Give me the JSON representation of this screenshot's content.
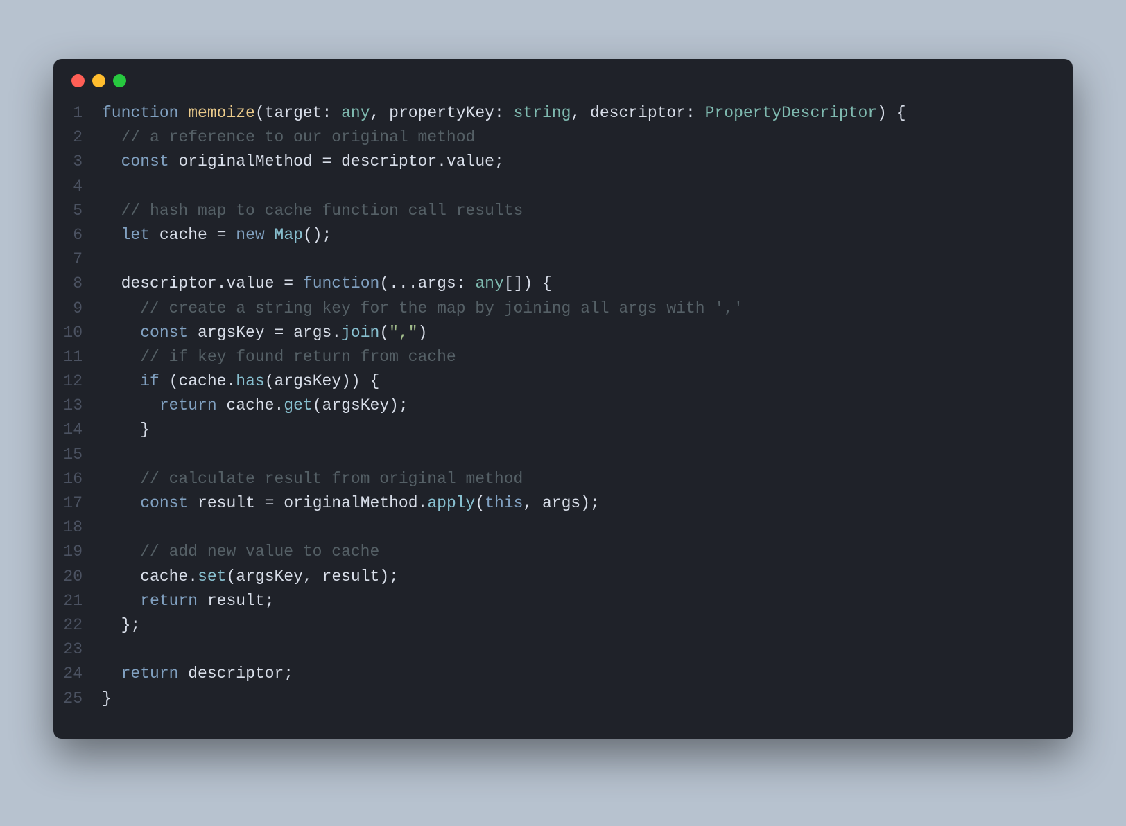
{
  "theme": {
    "pageBg": "#b7c2cf",
    "editorBg": "#1f2229",
    "lineNumber": "#4b5261",
    "default": "#d8dee9",
    "keyword": "#81a1c1",
    "keyword2": "#88c0d0",
    "function": "#ebcb8b",
    "type": "#7fbab0",
    "comment": "#556066",
    "string": "#a3be8c",
    "class": "#88c0d0",
    "trafficClose": "#ff5f56",
    "trafficMin": "#ffbd2e",
    "trafficMax": "#27c93f"
  },
  "lines": [
    {
      "n": 1,
      "tokens": [
        {
          "c": "kw",
          "t": "function"
        },
        {
          "c": "punc",
          "t": " "
        },
        {
          "c": "fn",
          "t": "memoize"
        },
        {
          "c": "punc",
          "t": "("
        },
        {
          "c": "id",
          "t": "target"
        },
        {
          "c": "punc",
          "t": ": "
        },
        {
          "c": "type",
          "t": "any"
        },
        {
          "c": "punc",
          "t": ", "
        },
        {
          "c": "id",
          "t": "propertyKey"
        },
        {
          "c": "punc",
          "t": ": "
        },
        {
          "c": "type",
          "t": "string"
        },
        {
          "c": "punc",
          "t": ", "
        },
        {
          "c": "id",
          "t": "descriptor"
        },
        {
          "c": "punc",
          "t": ": "
        },
        {
          "c": "type",
          "t": "PropertyDescriptor"
        },
        {
          "c": "punc",
          "t": ") {"
        }
      ]
    },
    {
      "n": 2,
      "tokens": [
        {
          "c": "punc",
          "t": "  "
        },
        {
          "c": "com",
          "t": "// a reference to our original method"
        }
      ]
    },
    {
      "n": 3,
      "tokens": [
        {
          "c": "punc",
          "t": "  "
        },
        {
          "c": "kw",
          "t": "const"
        },
        {
          "c": "punc",
          "t": " "
        },
        {
          "c": "id",
          "t": "originalMethod"
        },
        {
          "c": "punc",
          "t": " = "
        },
        {
          "c": "id",
          "t": "descriptor"
        },
        {
          "c": "punc",
          "t": "."
        },
        {
          "c": "prop",
          "t": "value"
        },
        {
          "c": "punc",
          "t": ";"
        }
      ]
    },
    {
      "n": 4,
      "tokens": []
    },
    {
      "n": 5,
      "tokens": [
        {
          "c": "punc",
          "t": "  "
        },
        {
          "c": "com",
          "t": "// hash map to cache function call results"
        }
      ]
    },
    {
      "n": 6,
      "tokens": [
        {
          "c": "punc",
          "t": "  "
        },
        {
          "c": "kw",
          "t": "let"
        },
        {
          "c": "punc",
          "t": " "
        },
        {
          "c": "id",
          "t": "cache"
        },
        {
          "c": "punc",
          "t": " = "
        },
        {
          "c": "kw",
          "t": "new"
        },
        {
          "c": "punc",
          "t": " "
        },
        {
          "c": "cls",
          "t": "Map"
        },
        {
          "c": "punc",
          "t": "();"
        }
      ]
    },
    {
      "n": 7,
      "tokens": []
    },
    {
      "n": 8,
      "tokens": [
        {
          "c": "punc",
          "t": "  "
        },
        {
          "c": "id",
          "t": "descriptor"
        },
        {
          "c": "punc",
          "t": "."
        },
        {
          "c": "prop",
          "t": "value"
        },
        {
          "c": "punc",
          "t": " = "
        },
        {
          "c": "kw",
          "t": "function"
        },
        {
          "c": "punc",
          "t": "(..."
        },
        {
          "c": "id",
          "t": "args"
        },
        {
          "c": "punc",
          "t": ": "
        },
        {
          "c": "type",
          "t": "any"
        },
        {
          "c": "punc",
          "t": "[]) {"
        }
      ]
    },
    {
      "n": 9,
      "tokens": [
        {
          "c": "punc",
          "t": "    "
        },
        {
          "c": "com",
          "t": "// create a string key for the map by joining all args with ','"
        }
      ]
    },
    {
      "n": 10,
      "tokens": [
        {
          "c": "punc",
          "t": "    "
        },
        {
          "c": "kw",
          "t": "const"
        },
        {
          "c": "punc",
          "t": " "
        },
        {
          "c": "id",
          "t": "argsKey"
        },
        {
          "c": "punc",
          "t": " = "
        },
        {
          "c": "id",
          "t": "args"
        },
        {
          "c": "punc",
          "t": "."
        },
        {
          "c": "kw2",
          "t": "join"
        },
        {
          "c": "punc",
          "t": "("
        },
        {
          "c": "str",
          "t": "\",\""
        },
        {
          "c": "punc",
          "t": ")"
        }
      ]
    },
    {
      "n": 11,
      "tokens": [
        {
          "c": "punc",
          "t": "    "
        },
        {
          "c": "com",
          "t": "// if key found return from cache"
        }
      ]
    },
    {
      "n": 12,
      "tokens": [
        {
          "c": "punc",
          "t": "    "
        },
        {
          "c": "kw",
          "t": "if"
        },
        {
          "c": "punc",
          "t": " ("
        },
        {
          "c": "id",
          "t": "cache"
        },
        {
          "c": "punc",
          "t": "."
        },
        {
          "c": "kw2",
          "t": "has"
        },
        {
          "c": "punc",
          "t": "("
        },
        {
          "c": "id",
          "t": "argsKey"
        },
        {
          "c": "punc",
          "t": ")) {"
        }
      ]
    },
    {
      "n": 13,
      "tokens": [
        {
          "c": "punc",
          "t": "      "
        },
        {
          "c": "kw",
          "t": "return"
        },
        {
          "c": "punc",
          "t": " "
        },
        {
          "c": "id",
          "t": "cache"
        },
        {
          "c": "punc",
          "t": "."
        },
        {
          "c": "kw2",
          "t": "get"
        },
        {
          "c": "punc",
          "t": "("
        },
        {
          "c": "id",
          "t": "argsKey"
        },
        {
          "c": "punc",
          "t": ");"
        }
      ]
    },
    {
      "n": 14,
      "tokens": [
        {
          "c": "punc",
          "t": "    }"
        }
      ]
    },
    {
      "n": 15,
      "tokens": []
    },
    {
      "n": 16,
      "tokens": [
        {
          "c": "punc",
          "t": "    "
        },
        {
          "c": "com",
          "t": "// calculate result from original method"
        }
      ]
    },
    {
      "n": 17,
      "tokens": [
        {
          "c": "punc",
          "t": "    "
        },
        {
          "c": "kw",
          "t": "const"
        },
        {
          "c": "punc",
          "t": " "
        },
        {
          "c": "id",
          "t": "result"
        },
        {
          "c": "punc",
          "t": " = "
        },
        {
          "c": "id",
          "t": "originalMethod"
        },
        {
          "c": "punc",
          "t": "."
        },
        {
          "c": "kw2",
          "t": "apply"
        },
        {
          "c": "punc",
          "t": "("
        },
        {
          "c": "this",
          "t": "this"
        },
        {
          "c": "punc",
          "t": ", "
        },
        {
          "c": "id",
          "t": "args"
        },
        {
          "c": "punc",
          "t": ");"
        }
      ]
    },
    {
      "n": 18,
      "tokens": []
    },
    {
      "n": 19,
      "tokens": [
        {
          "c": "punc",
          "t": "    "
        },
        {
          "c": "com",
          "t": "// add new value to cache"
        }
      ]
    },
    {
      "n": 20,
      "tokens": [
        {
          "c": "punc",
          "t": "    "
        },
        {
          "c": "id",
          "t": "cache"
        },
        {
          "c": "punc",
          "t": "."
        },
        {
          "c": "kw2",
          "t": "set"
        },
        {
          "c": "punc",
          "t": "("
        },
        {
          "c": "id",
          "t": "argsKey"
        },
        {
          "c": "punc",
          "t": ", "
        },
        {
          "c": "id",
          "t": "result"
        },
        {
          "c": "punc",
          "t": ");"
        }
      ]
    },
    {
      "n": 21,
      "tokens": [
        {
          "c": "punc",
          "t": "    "
        },
        {
          "c": "kw",
          "t": "return"
        },
        {
          "c": "punc",
          "t": " "
        },
        {
          "c": "id",
          "t": "result"
        },
        {
          "c": "punc",
          "t": ";"
        }
      ]
    },
    {
      "n": 22,
      "tokens": [
        {
          "c": "punc",
          "t": "  };"
        }
      ]
    },
    {
      "n": 23,
      "tokens": []
    },
    {
      "n": 24,
      "tokens": [
        {
          "c": "punc",
          "t": "  "
        },
        {
          "c": "kw",
          "t": "return"
        },
        {
          "c": "punc",
          "t": " "
        },
        {
          "c": "id",
          "t": "descriptor"
        },
        {
          "c": "punc",
          "t": ";"
        }
      ]
    },
    {
      "n": 25,
      "tokens": [
        {
          "c": "punc",
          "t": "}"
        }
      ]
    }
  ]
}
